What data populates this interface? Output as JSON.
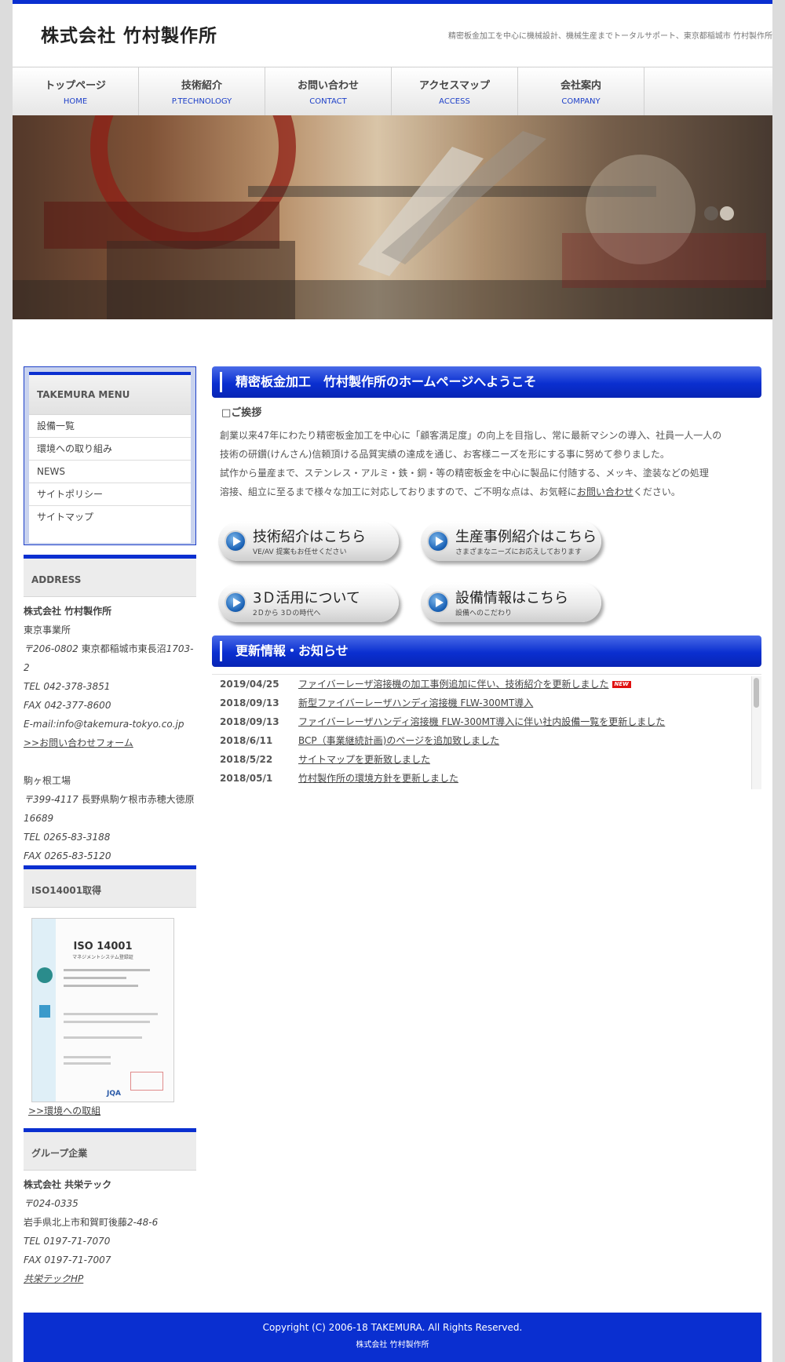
{
  "header": {
    "site_title": "株式会社 竹村製作所",
    "tagline": "精密板金加工を中心に機械設計、機械生産までトータルサポート、東京都稲城市 竹村製作所"
  },
  "nav": [
    {
      "ja": "トップページ",
      "en": "HOME"
    },
    {
      "ja": "技術紹介",
      "en": "P.TECHNOLOGY"
    },
    {
      "ja": "お問い合わせ",
      "en": "CONTACT"
    },
    {
      "ja": "アクセスマップ",
      "en": "ACCESS"
    },
    {
      "ja": "会社案内",
      "en": "COMPANY"
    }
  ],
  "sidebar": {
    "menu_title": "TAKEMURA MENU",
    "menu_items": [
      "設備一覧",
      "環境への取り組み",
      "NEWS",
      "サイトポリシー",
      "サイトマップ"
    ],
    "address_title": "ADDRESS",
    "company": "株式会社 竹村製作所",
    "office_name": "東京事業所",
    "office_postal": "〒206-0802",
    "office_address_a": "東京都稲城市東長沼",
    "office_address_b": "1703-",
    "office_address_c": "2",
    "office_tel": "TEL 042-378-3851",
    "office_fax": "FAX 042-377-8600",
    "office_email": "E-mail:info@takemura-tokyo.co.jp",
    "contact_link": ">>お問い合わせフォーム",
    "factory_name": "駒ヶ根工場",
    "factory_postal": "〒399-4117",
    "factory_address_a": "長野県駒ケ根市赤穂大徳原",
    "factory_address_b": "16689",
    "factory_tel": "TEL 0265-83-3188",
    "factory_fax": "FAX 0265-83-5120",
    "iso_title": "ISO14001取得",
    "iso_cert_title": "ISO 14001",
    "iso_cert_subtitle": "マネジメントシステム登録証",
    "iso_cert_mark": "JQA",
    "iso_link": ">>環境への取組",
    "group_title": "グループ企業",
    "group_company": "株式会社 共栄テック",
    "group_postal": "〒024-0335",
    "group_address_a": "岩手県北上市和賀町後藤",
    "group_address_b": "2-48-6",
    "group_tel": "TEL 0197-71-7070",
    "group_fax": "FAX 0197-71-7007",
    "group_link": "共栄テックHP"
  },
  "main": {
    "welcome_title": "精密板金加工　竹村製作所のホームページへようこそ",
    "greeting_title": "□ご挨拶",
    "intro_lines": [
      "創業以来47年にわたり精密板金加工を中心に「顧客満足度」の向上を目指し、常に最新マシンの導入、社員一人一人の",
      "技術の研鑽(けんさん)信頼頂ける品質実績の達成を通じ、お客様ニーズを形にする事に努めて参りました。",
      "試作から量産まで、ステンレス・アルミ・鉄・銅・等の精密板金を中心に製品に付随する、メッキ、塗装などの処理"
    ],
    "intro_last_prefix": "溶接、組立に至るまで様々な加工に対応しておりますので、ご不明な点は、お気軽に",
    "intro_last_link": "お問い合わせ",
    "intro_last_suffix": "ください。",
    "buttons": [
      {
        "main": "技術紹介はこちら",
        "sub": "VE/AV 提案もお任せください"
      },
      {
        "main": "生産事例紹介はこちら",
        "sub": "さまざまなニーズにお応えしております"
      },
      {
        "main": "3Ｄ活用について",
        "sub": "2Ｄから 3Ｄの時代へ"
      },
      {
        "main": "設備情報はこちら",
        "sub": "設備へのこだわり"
      }
    ],
    "news_title": "更新情報・お知らせ",
    "new_badge": "NEW",
    "news": [
      {
        "date": "2019/04/25",
        "text": "ファイバーレーザ溶接機の加工事例追加に伴い、技術紹介を更新しました"
      },
      {
        "date": "2018/09/13",
        "text": "新型ファイバーレーザハンディ溶接機 FLW-300MT導入"
      },
      {
        "date": "2018/09/13",
        "text": "ファイバーレーザハンディ溶接機 FLW-300MT導入に伴い社内設備一覧を更新しました"
      },
      {
        "date": "2018/6/11",
        "text": "BCP（事業継続計画)のページを追加致しました"
      },
      {
        "date": "2018/5/22",
        "text": "サイトマップを更新致しました"
      },
      {
        "date": "2018/05/1",
        "text": "竹村製作所の環境方針を更新しました"
      }
    ]
  },
  "footer": {
    "copyright": "Copyright (C) 2006-18 TAKEMURA. All Rights Reserved.",
    "company": "株式会社 竹村製作所"
  },
  "colors": {
    "accent_blue": "#0a2fd0",
    "link_blue": "#1d3fc8",
    "new_badge_red": "#e01010"
  }
}
